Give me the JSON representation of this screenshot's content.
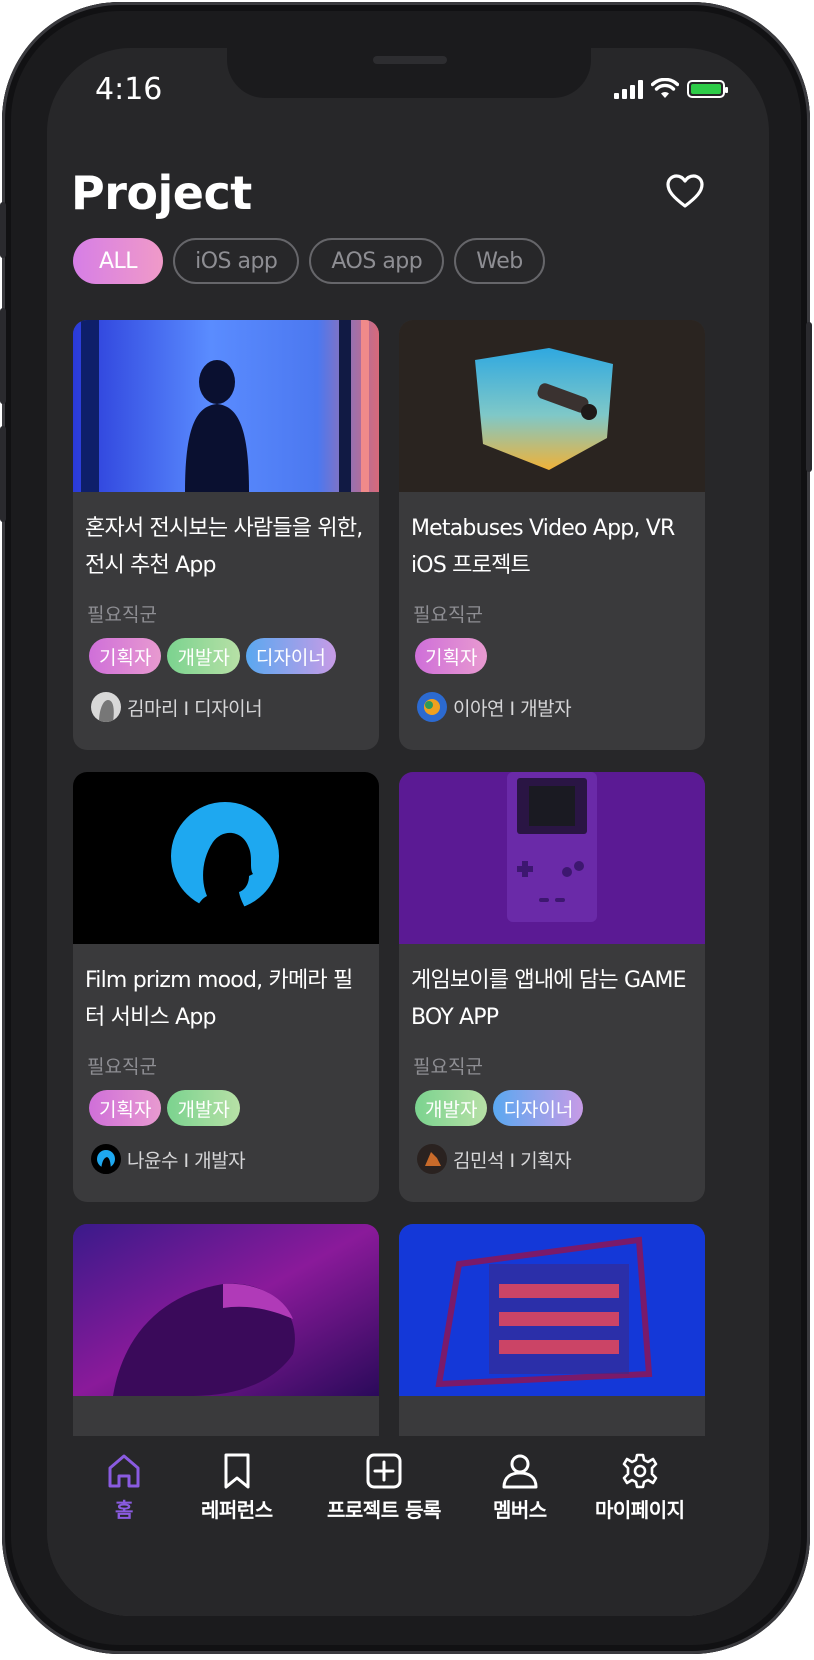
{
  "status": {
    "time": "4:16"
  },
  "page": {
    "title": "Project"
  },
  "colors": {
    "accent": "#8a5be0",
    "battery": "#2ecc48"
  },
  "filters": [
    {
      "label": "ALL",
      "active": true
    },
    {
      "label": "iOS app",
      "active": false
    },
    {
      "label": "AOS app",
      "active": false
    },
    {
      "label": "Web",
      "active": false
    }
  ],
  "projects": [
    {
      "title": "혼자서 전시보는 사람들을 위한, 전시 추천 App",
      "required_label": "필요직군",
      "tags": [
        "기획자",
        "개발자",
        "디자이너"
      ],
      "author": "김마리 I 디자이너"
    },
    {
      "title": "Metabuses Video App, VR iOS 프로젝트",
      "required_label": "필요직군",
      "tags": [
        "기획자"
      ],
      "author": "이아연 I 개발자"
    },
    {
      "title": "Film prizm mood, 카메라 필터 서비스 App",
      "required_label": "필요직군",
      "tags": [
        "기획자",
        "개발자"
      ],
      "author": "나윤수 I 개발자"
    },
    {
      "title": "게임보이를 앱내에 담는 GAME BOY APP",
      "required_label": "필요직군",
      "tags": [
        "개발자",
        "디자이너"
      ],
      "author": "김민석 I 기획자"
    }
  ],
  "tabbar": [
    {
      "label": "홈",
      "icon": "home-icon",
      "active": true
    },
    {
      "label": "레퍼런스",
      "icon": "bookmark-icon",
      "active": false
    },
    {
      "label": "프로젝트 등록",
      "icon": "add-square-icon",
      "active": false
    },
    {
      "label": "멤버스",
      "icon": "person-icon",
      "active": false
    },
    {
      "label": "마이페이지",
      "icon": "gear-icon",
      "active": false
    }
  ]
}
